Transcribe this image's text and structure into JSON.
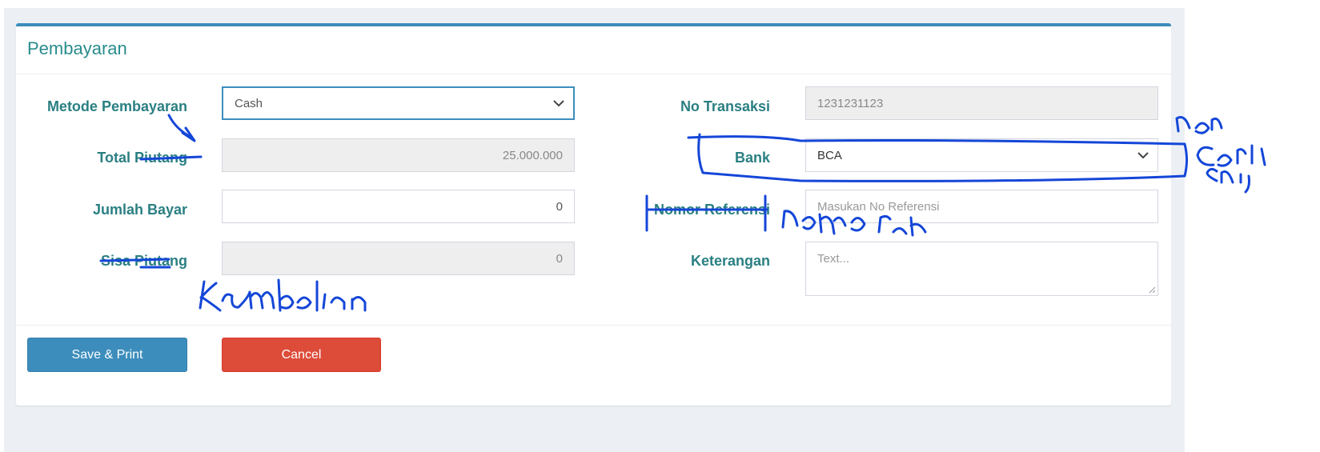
{
  "panel": {
    "title": "Pembayaran"
  },
  "left": {
    "metode_label": "Metode Pembayaran",
    "metode_value": "Cash",
    "total_label": "Total Piutang",
    "total_value": "25.000.000",
    "jumlah_label": "Jumlah Bayar",
    "jumlah_value": "0",
    "sisa_label": "Sisa Piutang",
    "sisa_value": "0"
  },
  "right": {
    "no_transaksi_label": "No Transaksi",
    "no_transaksi_value": "1231231123",
    "bank_label": "Bank",
    "bank_value": "BCA",
    "nomor_ref_label": "Nomor Referensi",
    "nomor_ref_placeholder": "Masukan No Referensi",
    "keterangan_label": "Keterangan",
    "keterangan_placeholder": "Text..."
  },
  "actions": {
    "save_label": "Save & Print",
    "cancel_label": "Cancel"
  },
  "icons": {
    "select_arrow": "chevron-down-icon",
    "resize_handle": "resize-grip-icon"
  },
  "colors": {
    "accent": "#3c8dbc",
    "label": "#2a7f82",
    "danger": "#dd4b39",
    "ink": "#1446d8"
  }
}
